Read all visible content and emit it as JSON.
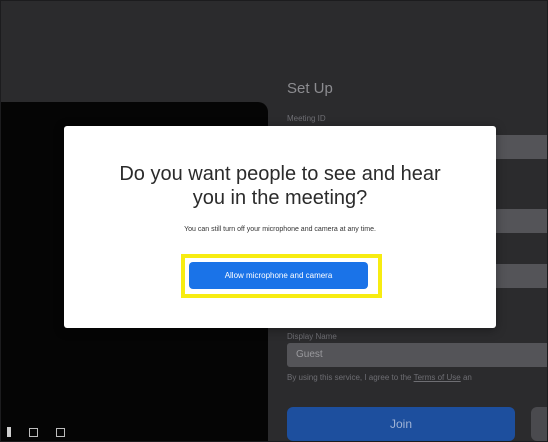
{
  "setup": {
    "title": "Set Up",
    "meeting_id_label": "Meeting ID",
    "display_name_label": "Display Name",
    "display_name_value": "Guest",
    "agree_prefix": "By using this service, I agree to the ",
    "agree_link": "Terms of Use",
    "agree_suffix": " an",
    "join_label": "Join"
  },
  "dialog": {
    "title_line1": "Do you want people to see and hear",
    "title_line2": "you in the meeting?",
    "subtitle": "You can still turn off your microphone and camera at any time.",
    "allow_button": "Allow microphone and camera"
  },
  "colors": {
    "allow_button": "#1a73e8",
    "highlight": "#f7ec11",
    "join_button": "#1d4f9e"
  }
}
